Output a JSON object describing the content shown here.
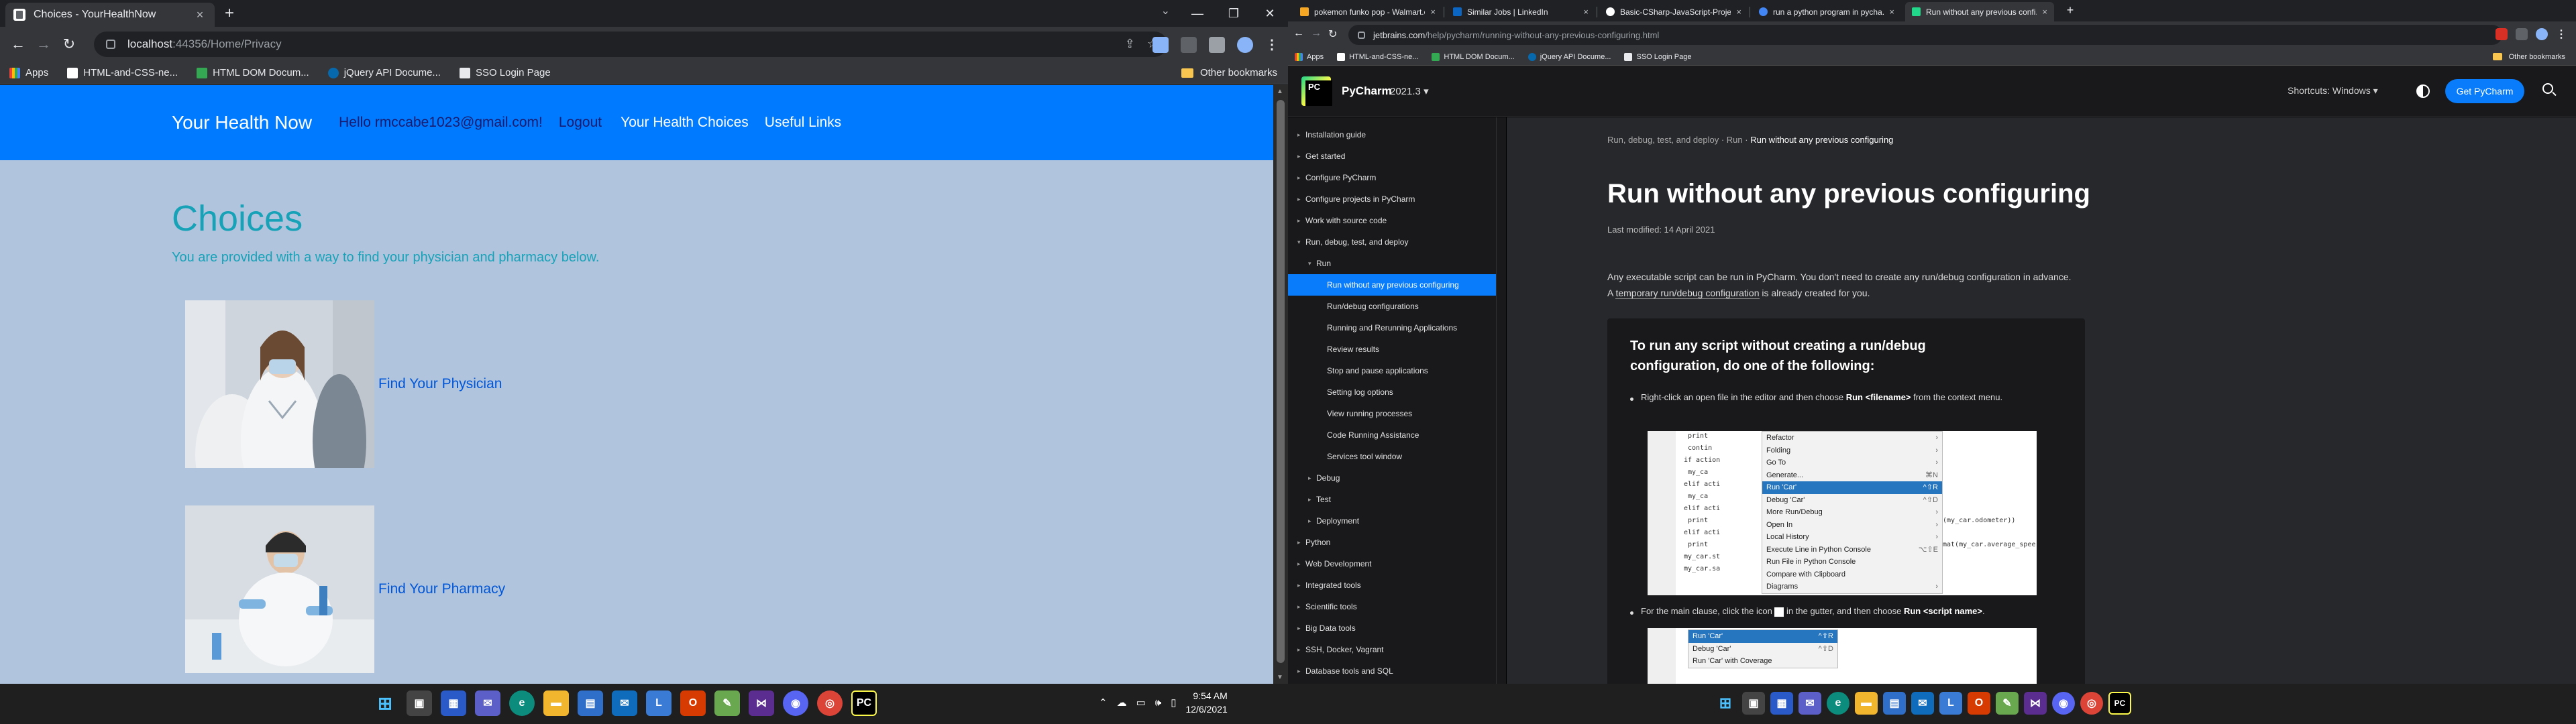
{
  "left": {
    "tab": {
      "title": "Choices - YourHealthNow"
    },
    "window_controls": {
      "minimize": "—",
      "restore": "❐",
      "close": "✕"
    },
    "address": {
      "host": "localhost",
      "path": ":44356/Home/Privacy"
    },
    "bookmarks": [
      "Apps",
      "HTML-and-CSS-ne...",
      "HTML DOM Docum...",
      "jQuery API Docume...",
      "SSO Login Page"
    ],
    "other_bookmarks": "Other bookmarks",
    "site": {
      "brand": "Your Health Now",
      "hello": "Hello rmccabe1023@gmail.com!",
      "logout": "Logout",
      "nav_links": [
        "Your Health Choices",
        "Useful Links"
      ],
      "heading": "Choices",
      "lead": "You are provided with a way to find your physician and pharmacy below.",
      "choices": [
        {
          "link": "Find Your Physician"
        },
        {
          "link": "Find Your Pharmacy"
        }
      ]
    },
    "clock": {
      "time": "9:54 AM",
      "date": "12/6/2021"
    }
  },
  "right": {
    "tabs": [
      {
        "title": "pokemon funko pop - Walmart.co...",
        "color": "#f5a623"
      },
      {
        "title": "Similar Jobs | LinkedIn",
        "color": "#0a66c2"
      },
      {
        "title": "Basic-CSharp-JavaScript-Project...",
        "color": "#ffffff"
      },
      {
        "title": "run a python program in pycha...",
        "color": "#4285f4"
      },
      {
        "title": "Run without any previous confi...",
        "color": "#21d789"
      }
    ],
    "address": {
      "host": "jetbrains.com",
      "path": "/help/pycharm/running-without-any-previous-configuring.html"
    },
    "bookmarks": [
      "Apps",
      "HTML-and-CSS-ne...",
      "HTML DOM Docum...",
      "jQuery API Docume...",
      "SSO Login Page"
    ],
    "other_bookmarks": "Other bookmarks",
    "header": {
      "product": "PyCharm",
      "version": "2021.3",
      "shortcuts": "Shortcuts: Windows",
      "cta": "Get PyCharm"
    },
    "sidebar": [
      {
        "label": "Installation guide",
        "caret": "▸"
      },
      {
        "label": "Get started",
        "caret": "▸"
      },
      {
        "label": "Configure PyCharm",
        "caret": "▸"
      },
      {
        "label": "Configure projects in PyCharm",
        "caret": "▸"
      },
      {
        "label": "Work with source code",
        "caret": "▸"
      },
      {
        "label": "Run, debug, test, and deploy",
        "caret": "▾"
      },
      {
        "label": "Run",
        "caret": "▾"
      },
      {
        "label": "Run without any previous configuring",
        "caret": ""
      },
      {
        "label": "Run/debug configurations",
        "caret": ""
      },
      {
        "label": "Running and Rerunning Applications",
        "caret": ""
      },
      {
        "label": "Review results",
        "caret": ""
      },
      {
        "label": "Stop and pause applications",
        "caret": ""
      },
      {
        "label": "Setting log options",
        "caret": ""
      },
      {
        "label": "View running processes",
        "caret": ""
      },
      {
        "label": "Code Running Assistance",
        "caret": ""
      },
      {
        "label": "Services tool window",
        "caret": ""
      },
      {
        "label": "Debug",
        "caret": "▸"
      },
      {
        "label": "Test",
        "caret": "▸"
      },
      {
        "label": "Deployment",
        "caret": "▸"
      },
      {
        "label": "Python",
        "caret": "▸"
      },
      {
        "label": "Web Development",
        "caret": "▸"
      },
      {
        "label": "Integrated tools",
        "caret": "▸"
      },
      {
        "label": "Scientific tools",
        "caret": "▸"
      },
      {
        "label": "Big Data tools",
        "caret": "▸"
      },
      {
        "label": "SSH, Docker, Vagrant",
        "caret": "▸"
      },
      {
        "label": "Database tools and SQL",
        "caret": "▸"
      }
    ],
    "doc": {
      "breadcrumb_1": "Run, debug, test, and deploy",
      "breadcrumb_sep": " · ",
      "breadcrumb_2": "Run",
      "breadcrumb_3": "Run without any previous configuring",
      "title": "Run without any previous configuring",
      "modified": "Last modified: 14 April 2021",
      "intro_1": "Any executable script can be run in PyCharm. You don't need to create any run/debug configuration in advance. A ",
      "intro_link": "temporary run/debug configuration",
      "intro_2": " is already created for you.",
      "procedure_title": "To run any script without creating a run/debug configuration, do one of the following:",
      "step1_a": "Right-click an open file in the editor and then choose ",
      "step1_b": "Run <filename>",
      "step1_c": " from the context menu.",
      "step2_a": "For the main clause, click the icon ",
      "step2_b": " in the gutter, and then choose ",
      "step2_c": "Run <script name>",
      "step2_d": "."
    },
    "context_menu": [
      {
        "label": "Refactor",
        "shortcut": "›"
      },
      {
        "label": "Folding",
        "shortcut": "›"
      },
      {
        "label": "Go To",
        "shortcut": "›"
      },
      {
        "label": "Generate...",
        "shortcut": "⌘N"
      },
      {
        "label": "Run 'Car'",
        "shortcut": "^⇧R"
      },
      {
        "label": "Debug 'Car'",
        "shortcut": "^⇧D"
      },
      {
        "label": "More Run/Debug",
        "shortcut": "›"
      },
      {
        "label": "Open In",
        "shortcut": "›"
      },
      {
        "label": "Local History",
        "shortcut": "›"
      },
      {
        "label": "Execute Line in Python Console",
        "shortcut": "⌥⇧E"
      },
      {
        "label": "Run File in Python Console",
        "shortcut": ""
      },
      {
        "label": "Compare with Clipboard",
        "shortcut": ""
      },
      {
        "label": "Diagrams",
        "shortcut": "›"
      }
    ],
    "gutter_menu": [
      {
        "label": "Run 'Car'",
        "shortcut": "^⇧R"
      },
      {
        "label": "Debug 'Car'",
        "shortcut": "^⇧D"
      },
      {
        "label": "Run 'Car' with Coverage",
        "shortcut": ""
      }
    ]
  }
}
